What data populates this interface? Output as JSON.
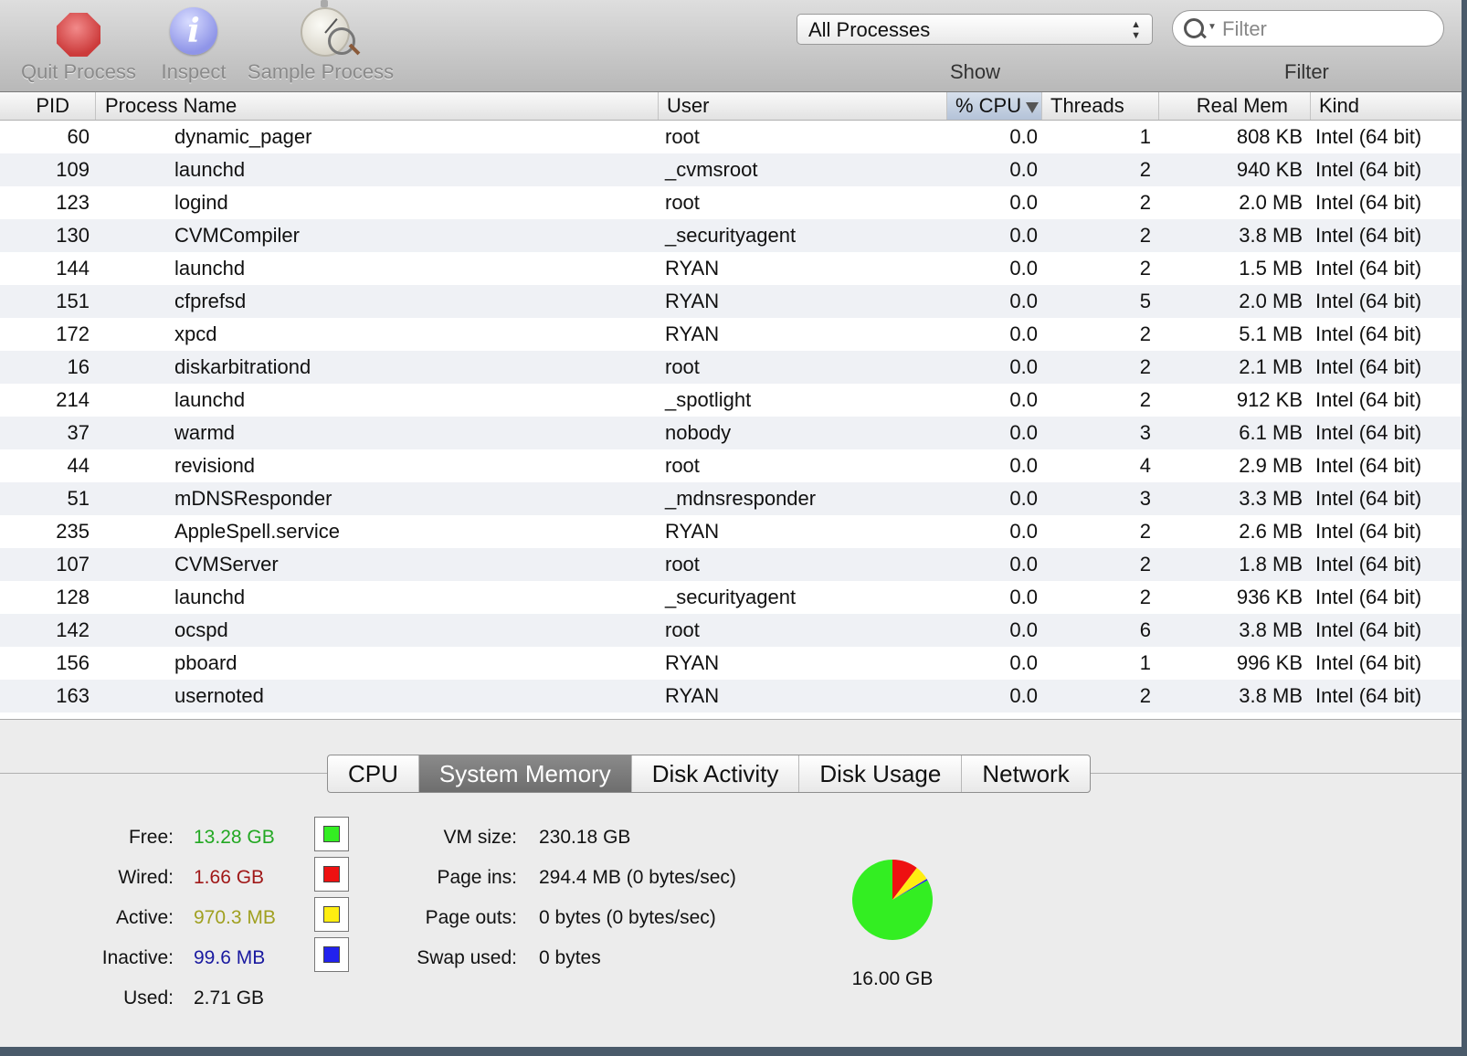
{
  "toolbar": {
    "quit_label": "Quit Process",
    "inspect_label": "Inspect",
    "sample_label": "Sample Process",
    "show_select": "All Processes",
    "show_label": "Show",
    "filter_placeholder": "Filter",
    "filter_label": "Filter"
  },
  "columns": {
    "pid": "PID",
    "name": "Process Name",
    "user": "User",
    "cpu": "% CPU",
    "threads": "Threads",
    "mem": "Real Mem",
    "kind": "Kind"
  },
  "processes": [
    {
      "pid": "60",
      "name": "dynamic_pager",
      "user": "root",
      "cpu": "0.0",
      "threads": "1",
      "mem": "808 KB",
      "kind": "Intel (64 bit)"
    },
    {
      "pid": "109",
      "name": "launchd",
      "user": "_cvmsroot",
      "cpu": "0.0",
      "threads": "2",
      "mem": "940 KB",
      "kind": "Intel (64 bit)"
    },
    {
      "pid": "123",
      "name": "logind",
      "user": "root",
      "cpu": "0.0",
      "threads": "2",
      "mem": "2.0 MB",
      "kind": "Intel (64 bit)"
    },
    {
      "pid": "130",
      "name": "CVMCompiler",
      "user": "_securityagent",
      "cpu": "0.0",
      "threads": "2",
      "mem": "3.8 MB",
      "kind": "Intel (64 bit)"
    },
    {
      "pid": "144",
      "name": "launchd",
      "user": "RYAN",
      "cpu": "0.0",
      "threads": "2",
      "mem": "1.5 MB",
      "kind": "Intel (64 bit)"
    },
    {
      "pid": "151",
      "name": "cfprefsd",
      "user": "RYAN",
      "cpu": "0.0",
      "threads": "5",
      "mem": "2.0 MB",
      "kind": "Intel (64 bit)"
    },
    {
      "pid": "172",
      "name": "xpcd",
      "user": "RYAN",
      "cpu": "0.0",
      "threads": "2",
      "mem": "5.1 MB",
      "kind": "Intel (64 bit)"
    },
    {
      "pid": "16",
      "name": "diskarbitrationd",
      "user": "root",
      "cpu": "0.0",
      "threads": "2",
      "mem": "2.1 MB",
      "kind": "Intel (64 bit)"
    },
    {
      "pid": "214",
      "name": "launchd",
      "user": "_spotlight",
      "cpu": "0.0",
      "threads": "2",
      "mem": "912 KB",
      "kind": "Intel (64 bit)"
    },
    {
      "pid": "37",
      "name": "warmd",
      "user": "nobody",
      "cpu": "0.0",
      "threads": "3",
      "mem": "6.1 MB",
      "kind": "Intel (64 bit)"
    },
    {
      "pid": "44",
      "name": "revisiond",
      "user": "root",
      "cpu": "0.0",
      "threads": "4",
      "mem": "2.9 MB",
      "kind": "Intel (64 bit)"
    },
    {
      "pid": "51",
      "name": "mDNSResponder",
      "user": "_mdnsresponder",
      "cpu": "0.0",
      "threads": "3",
      "mem": "3.3 MB",
      "kind": "Intel (64 bit)"
    },
    {
      "pid": "235",
      "name": "AppleSpell.service",
      "user": "RYAN",
      "cpu": "0.0",
      "threads": "2",
      "mem": "2.6 MB",
      "kind": "Intel (64 bit)"
    },
    {
      "pid": "107",
      "name": "CVMServer",
      "user": "root",
      "cpu": "0.0",
      "threads": "2",
      "mem": "1.8 MB",
      "kind": "Intel (64 bit)"
    },
    {
      "pid": "128",
      "name": "launchd",
      "user": "_securityagent",
      "cpu": "0.0",
      "threads": "2",
      "mem": "936 KB",
      "kind": "Intel (64 bit)"
    },
    {
      "pid": "142",
      "name": "ocspd",
      "user": "root",
      "cpu": "0.0",
      "threads": "6",
      "mem": "3.8 MB",
      "kind": "Intel (64 bit)"
    },
    {
      "pid": "156",
      "name": "pboard",
      "user": "RYAN",
      "cpu": "0.0",
      "threads": "1",
      "mem": "996 KB",
      "kind": "Intel (64 bit)"
    },
    {
      "pid": "163",
      "name": "usernoted",
      "user": "RYAN",
      "cpu": "0.0",
      "threads": "2",
      "mem": "3.8 MB",
      "kind": "Intel (64 bit)"
    }
  ],
  "tabs": [
    {
      "label": "CPU",
      "active": false
    },
    {
      "label": "System Memory",
      "active": true
    },
    {
      "label": "Disk Activity",
      "active": false
    },
    {
      "label": "Disk Usage",
      "active": false
    },
    {
      "label": "Network",
      "active": false
    }
  ],
  "memory": {
    "free": {
      "label": "Free:",
      "value": "13.28 GB",
      "color": "#22a822",
      "swatch": "#33ee22",
      "gb": 13.28
    },
    "wired": {
      "label": "Wired:",
      "value": "1.66 GB",
      "color": "#a01818",
      "swatch": "#ee1111",
      "gb": 1.66
    },
    "active": {
      "label": "Active:",
      "value": "970.3 MB",
      "color": "#a0a020",
      "swatch": "#ffee11",
      "gb": 0.9475
    },
    "inactive": {
      "label": "Inactive:",
      "value": "99.6 MB",
      "color": "#1a1aa0",
      "swatch": "#2222ee",
      "gb": 0.0973
    },
    "used": {
      "label": "Used:",
      "value": "2.71 GB"
    }
  },
  "vm": {
    "size": {
      "label": "VM size:",
      "value": "230.18 GB"
    },
    "page_ins": {
      "label": "Page ins:",
      "value": "294.4 MB (0 bytes/sec)"
    },
    "page_outs": {
      "label": "Page outs:",
      "value": "0 bytes (0 bytes/sec)"
    },
    "swap": {
      "label": "Swap used:",
      "value": "0 bytes"
    }
  },
  "total_memory": "16.00 GB"
}
